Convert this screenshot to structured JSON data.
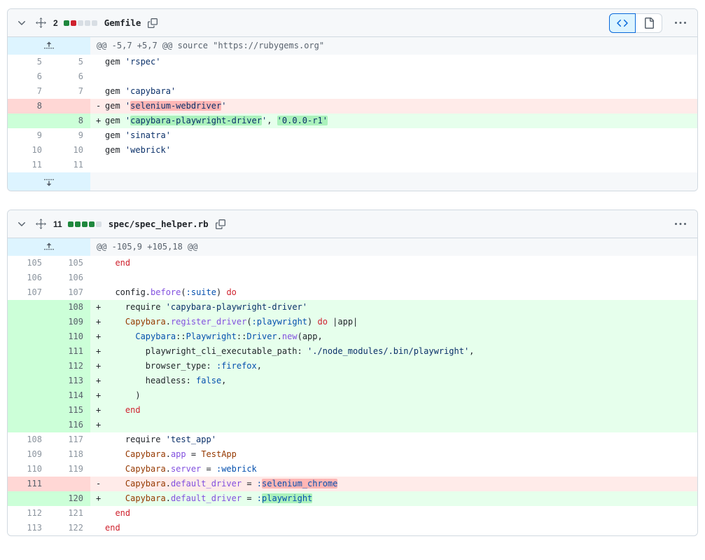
{
  "colors": {
    "accent_blue": "#0969da",
    "header_bg": "#f6f8fa",
    "card_border": "#d1d9e0",
    "expander_bg": "#ddf4ff",
    "addition_line_bg": "#e6ffec",
    "addition_num_bg": "#ccffd8",
    "addition_word_bg": "#abf2bc",
    "deletion_line_bg": "#ffebe9",
    "deletion_num_bg": "#ffd7d5",
    "deletion_word_bg": "#ffb3b8",
    "diffstat_add": "#1f883d",
    "diffstat_del": "#cf222e",
    "diffstat_neutral": "#d8dee4"
  },
  "icons": {
    "collapse": "chevron-down-icon",
    "drag": "drag-handle-icon",
    "copy": "copy-icon",
    "source_diff": "code-icon",
    "rich_diff": "file-icon",
    "options": "kebab-horizontal-icon",
    "expand_up": "fold-up-icon",
    "expand_down": "fold-down-icon"
  },
  "files": [
    {
      "name": "Gemfile",
      "changes": "2",
      "diffstat": [
        "add",
        "del",
        "n",
        "n",
        "n"
      ],
      "show_view_toggle": true,
      "view_toggle_selected": "source",
      "rows": [
        {
          "type": "hunk",
          "icon": "fold-up-icon",
          "text": "@@ -5,7 +5,7 @@ source \"https://rubygems.org\""
        },
        {
          "type": "context",
          "old": "5",
          "new": "5",
          "tokens": [
            [
              "pl",
              "gem "
            ],
            [
              "s",
              "'rspec'"
            ]
          ]
        },
        {
          "type": "context",
          "old": "6",
          "new": "6",
          "tokens": []
        },
        {
          "type": "context",
          "old": "7",
          "new": "7",
          "tokens": [
            [
              "pl",
              "gem "
            ],
            [
              "s",
              "'capybara'"
            ]
          ]
        },
        {
          "type": "del",
          "old": "8",
          "new": "",
          "tokens": [
            [
              "pl",
              "gem "
            ],
            [
              "s",
              "'"
            ],
            [
              "s hd",
              "selenium-webdriver"
            ],
            [
              "s",
              "'"
            ]
          ]
        },
        {
          "type": "add",
          "old": "",
          "new": "8",
          "tokens": [
            [
              "pl",
              "gem "
            ],
            [
              "s",
              "'"
            ],
            [
              "s ha",
              "capybara-playwright-driver"
            ],
            [
              "s",
              "'"
            ],
            [
              "pl",
              ", "
            ],
            [
              "s ha",
              "'0.0.0-r1'"
            ]
          ]
        },
        {
          "type": "context",
          "old": "9",
          "new": "9",
          "tokens": [
            [
              "pl",
              "gem "
            ],
            [
              "s",
              "'sinatra'"
            ]
          ]
        },
        {
          "type": "context",
          "old": "10",
          "new": "10",
          "tokens": [
            [
              "pl",
              "gem "
            ],
            [
              "s",
              "'webrick'"
            ]
          ]
        },
        {
          "type": "context",
          "old": "11",
          "new": "11",
          "tokens": []
        },
        {
          "type": "expand",
          "icon": "fold-down-icon"
        }
      ]
    },
    {
      "name": "spec/spec_helper.rb",
      "changes": "11",
      "diffstat": [
        "add",
        "add",
        "add",
        "add",
        "n"
      ],
      "show_view_toggle": false,
      "view_toggle_selected": "",
      "rows": [
        {
          "type": "hunk",
          "icon": "fold-up-icon",
          "text": "@@ -105,9 +105,18 @@"
        },
        {
          "type": "context",
          "old": "105",
          "new": "105",
          "tokens": [
            [
              "pl",
              "  "
            ],
            [
              "k",
              "end"
            ]
          ]
        },
        {
          "type": "context",
          "old": "106",
          "new": "106",
          "tokens": []
        },
        {
          "type": "context",
          "old": "107",
          "new": "107",
          "tokens": [
            [
              "pl",
              "  config."
            ],
            [
              "fn",
              "before"
            ],
            [
              "pl",
              "("
            ],
            [
              "c1",
              ":suite"
            ],
            [
              "pl",
              ") "
            ],
            [
              "k",
              "do"
            ]
          ]
        },
        {
          "type": "add",
          "old": "",
          "new": "108",
          "tokens": [
            [
              "pl",
              "    require "
            ],
            [
              "s",
              "'capybara-playwright-driver'"
            ]
          ]
        },
        {
          "type": "add",
          "old": "",
          "new": "109",
          "tokens": [
            [
              "pl",
              "    "
            ],
            [
              "v",
              "Capybara"
            ],
            [
              "pl",
              "."
            ],
            [
              "fn",
              "register_driver"
            ],
            [
              "pl",
              "("
            ],
            [
              "c1",
              ":playwright"
            ],
            [
              "pl",
              ") "
            ],
            [
              "k",
              "do"
            ],
            [
              "pl",
              " |app|"
            ]
          ]
        },
        {
          "type": "add",
          "old": "",
          "new": "110",
          "tokens": [
            [
              "pl",
              "      "
            ],
            [
              "c1",
              "Capybara"
            ],
            [
              "pl",
              "::"
            ],
            [
              "c1",
              "Playwright"
            ],
            [
              "pl",
              "::"
            ],
            [
              "c1",
              "Driver"
            ],
            [
              "pl",
              "."
            ],
            [
              "fn",
              "new"
            ],
            [
              "pl",
              "(app,"
            ]
          ]
        },
        {
          "type": "add",
          "old": "",
          "new": "111",
          "tokens": [
            [
              "pl",
              "        playwright_cli_executable_path: "
            ],
            [
              "s",
              "'./node_modules/.bin/playwright'"
            ],
            [
              "pl",
              ","
            ]
          ]
        },
        {
          "type": "add",
          "old": "",
          "new": "112",
          "tokens": [
            [
              "pl",
              "        browser_type: "
            ],
            [
              "c1",
              ":firefox"
            ],
            [
              "pl",
              ","
            ]
          ]
        },
        {
          "type": "add",
          "old": "",
          "new": "113",
          "tokens": [
            [
              "pl",
              "        headless: "
            ],
            [
              "c1",
              "false"
            ],
            [
              "pl",
              ","
            ]
          ]
        },
        {
          "type": "add",
          "old": "",
          "new": "114",
          "tokens": [
            [
              "pl",
              "      )"
            ]
          ]
        },
        {
          "type": "add",
          "old": "",
          "new": "115",
          "tokens": [
            [
              "pl",
              "    "
            ],
            [
              "k",
              "end"
            ]
          ]
        },
        {
          "type": "add",
          "old": "",
          "new": "116",
          "tokens": []
        },
        {
          "type": "context",
          "old": "108",
          "new": "117",
          "tokens": [
            [
              "pl",
              "    require "
            ],
            [
              "s",
              "'test_app'"
            ]
          ]
        },
        {
          "type": "context",
          "old": "109",
          "new": "118",
          "tokens": [
            [
              "pl",
              "    "
            ],
            [
              "v",
              "Capybara"
            ],
            [
              "pl",
              "."
            ],
            [
              "fn",
              "app"
            ],
            [
              "pl",
              " = "
            ],
            [
              "v",
              "TestApp"
            ]
          ]
        },
        {
          "type": "context",
          "old": "110",
          "new": "119",
          "tokens": [
            [
              "pl",
              "    "
            ],
            [
              "v",
              "Capybara"
            ],
            [
              "pl",
              "."
            ],
            [
              "fn",
              "server"
            ],
            [
              "pl",
              " = "
            ],
            [
              "c1",
              ":webrick"
            ]
          ]
        },
        {
          "type": "del",
          "old": "111",
          "new": "",
          "tokens": [
            [
              "pl",
              "    "
            ],
            [
              "v",
              "Capybara"
            ],
            [
              "pl",
              "."
            ],
            [
              "fn",
              "default_driver"
            ],
            [
              "pl",
              " = "
            ],
            [
              "c1",
              ":"
            ],
            [
              "c1 hd",
              "selenium_chrome"
            ]
          ]
        },
        {
          "type": "add",
          "old": "",
          "new": "120",
          "tokens": [
            [
              "pl",
              "    "
            ],
            [
              "v",
              "Capybara"
            ],
            [
              "pl",
              "."
            ],
            [
              "fn",
              "default_driver"
            ],
            [
              "pl",
              " = "
            ],
            [
              "c1",
              ":"
            ],
            [
              "c1 ha",
              "playwright"
            ]
          ]
        },
        {
          "type": "context",
          "old": "112",
          "new": "121",
          "tokens": [
            [
              "pl",
              "  "
            ],
            [
              "k",
              "end"
            ]
          ]
        },
        {
          "type": "context",
          "old": "113",
          "new": "122",
          "tokens": [
            [
              "k",
              "end"
            ]
          ]
        }
      ]
    }
  ]
}
